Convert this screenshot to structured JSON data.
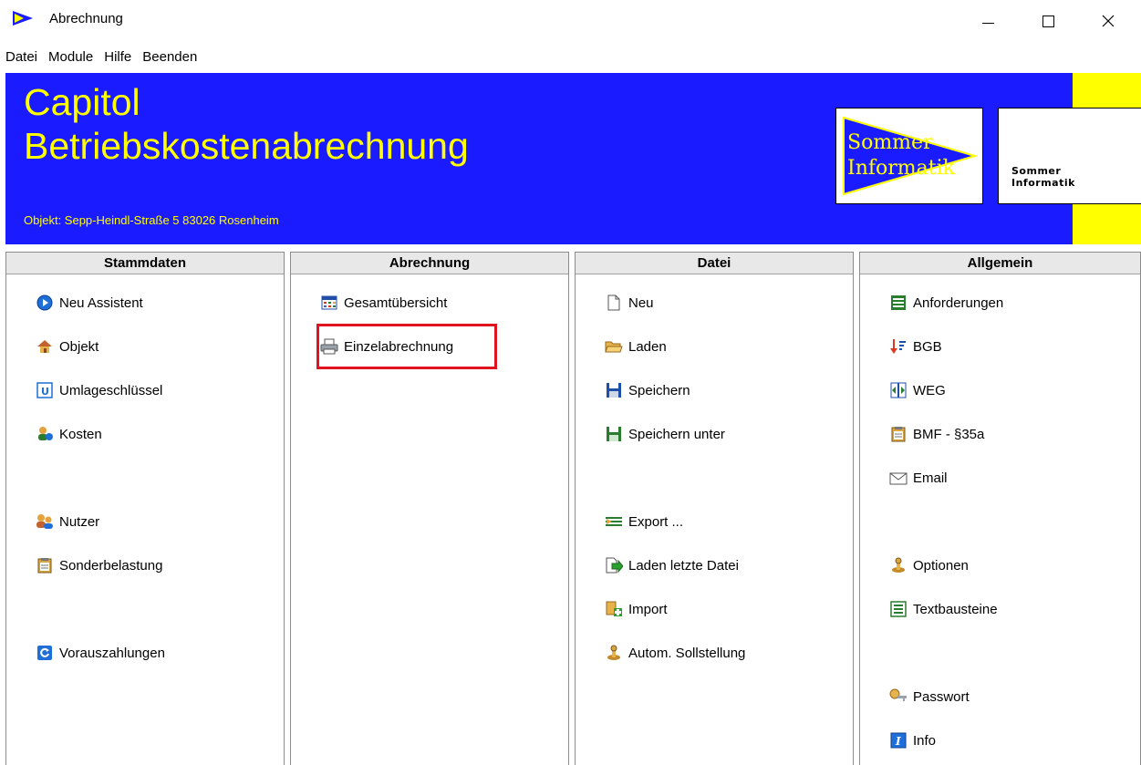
{
  "window": {
    "title": "Abrechnung"
  },
  "menubar": {
    "items": [
      "Datei",
      "Module",
      "Hilfe",
      "Beenden"
    ]
  },
  "banner": {
    "title_line1": "Capitol",
    "title_line2": "Betriebskostenabrechnung",
    "object_text": "Objekt: Sepp-Heindl-Straße 5  83026 Rosenheim",
    "logo_pennant_text": [
      "Sommer",
      "Informatik"
    ],
    "logo_text_line1": "Sommer",
    "logo_text_line2": "Informatik",
    "color_background": "#1b1bff",
    "color_text": "#ffff00"
  },
  "panels": {
    "stammdaten": {
      "header": "Stammdaten",
      "items": [
        "Neu Assistent",
        "Objekt",
        "Umlageschlüssel",
        "Kosten",
        "Nutzer",
        "Sonderbelastung",
        "Vorauszahlungen"
      ]
    },
    "abrechnung": {
      "header": "Abrechnung",
      "items": [
        "Gesamtübersicht",
        "Einzelabrechnung"
      ]
    },
    "datei": {
      "header": "Datei",
      "items": [
        "Neu",
        "Laden",
        "Speichern",
        "Speichern unter",
        "Export ...",
        "Laden letzte Datei",
        "Import",
        "Autom. Sollstellung"
      ]
    },
    "allgemein": {
      "header": "Allgemein",
      "items": [
        "Anforderungen",
        "BGB",
        "WEG",
        "BMF - §35a",
        "Email",
        "Optionen",
        "Textbausteine",
        "Passwort",
        "Info"
      ]
    }
  },
  "highlight_color": "#e0141e"
}
